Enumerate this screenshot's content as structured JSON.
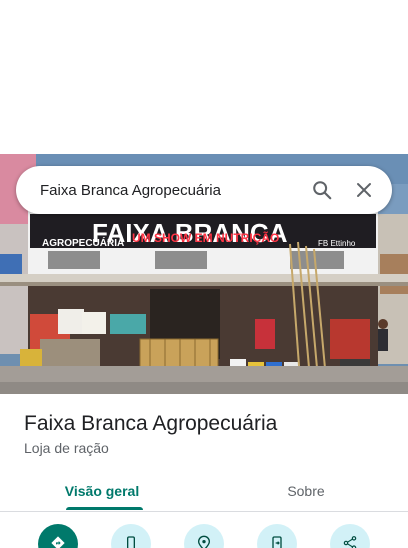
{
  "search": {
    "query": "Faixa Branca Agropecuária",
    "search_icon": "search-icon",
    "close_icon": "close-icon"
  },
  "photo": {
    "sign_main": "FAIXA BRANCA",
    "sign_left": "AGROPECUÁRIA",
    "sign_slogan": "UM SHOW EM NUTRIÇÃO",
    "sign_right": "FB Ettinho"
  },
  "place": {
    "name": "Faixa Branca Agropecuária",
    "category": "Loja de ração"
  },
  "tabs": [
    {
      "label": "Visão geral",
      "selected": true
    },
    {
      "label": "Sobre",
      "selected": false
    }
  ],
  "actions": [
    {
      "icon": "directions-icon"
    },
    {
      "icon": "phone-icon"
    },
    {
      "icon": "save-location-icon"
    },
    {
      "icon": "send-to-phone-icon"
    },
    {
      "icon": "share-icon"
    }
  ],
  "colors": {
    "accent": "#00796b",
    "action_bg": "#d2f1f7"
  }
}
